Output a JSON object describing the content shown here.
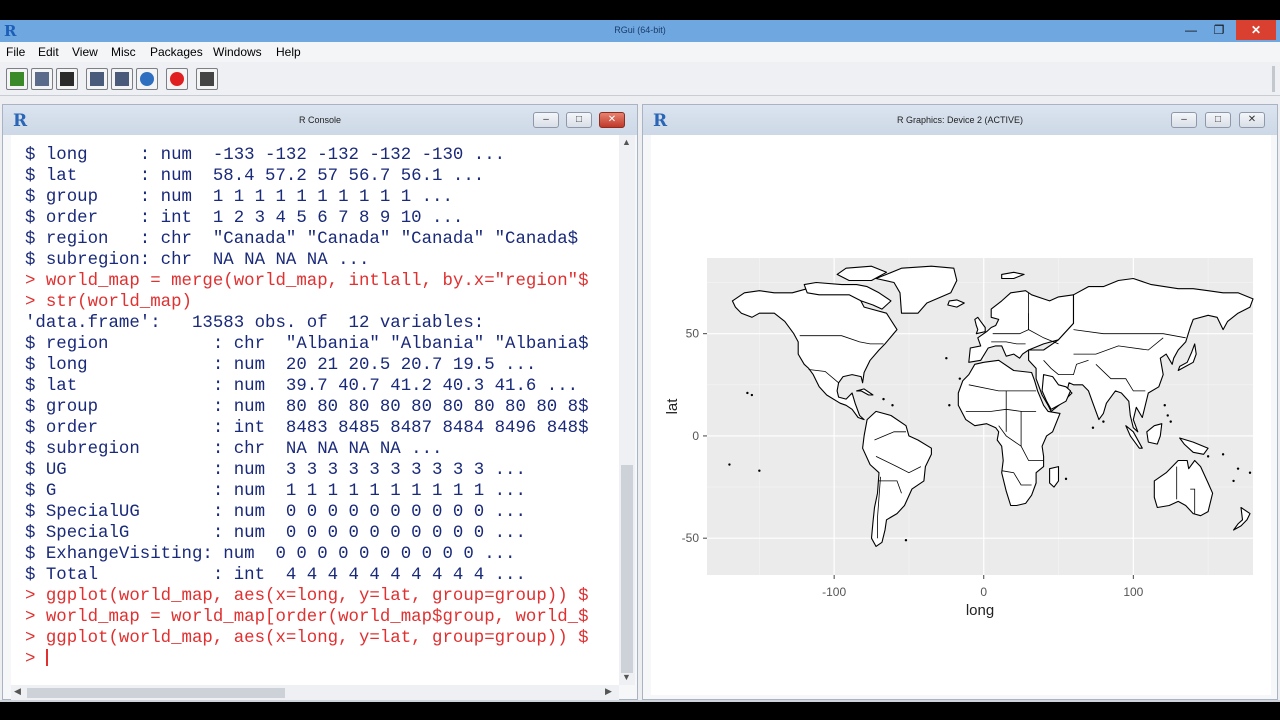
{
  "app": {
    "title": "RGui (64-bit)",
    "menu": [
      "File",
      "Edit",
      "View",
      "Misc",
      "Packages",
      "Windows",
      "Help"
    ],
    "toolbar": [
      {
        "name": "open-script-icon",
        "color": "#3a8a2a"
      },
      {
        "name": "load-workspace-icon",
        "color": "#5a6a8a"
      },
      {
        "name": "save-workspace-icon",
        "color": "#2b2b2b"
      },
      {
        "name": "copy-icon",
        "color": "#4a5a7a"
      },
      {
        "name": "copy-paste-icon",
        "color": "#4a5a7a"
      },
      {
        "name": "refresh-icon",
        "color": "#2f6fbf"
      },
      {
        "name": "stop-icon",
        "color": "#e02020"
      },
      {
        "name": "print-icon",
        "color": "#444444"
      }
    ]
  },
  "console": {
    "title": "R Console",
    "lines": [
      {
        "type": "out",
        "text": "$ long     : num  -133 -132 -132 -132 -130 ..."
      },
      {
        "type": "out",
        "text": "$ lat      : num  58.4 57.2 57 56.7 56.1 ..."
      },
      {
        "type": "out",
        "text": "$ group    : num  1 1 1 1 1 1 1 1 1 1 ..."
      },
      {
        "type": "out",
        "text": "$ order    : int  1 2 3 4 5 6 7 8 9 10 ..."
      },
      {
        "type": "out",
        "text": "$ region   : chr  \"Canada\" \"Canada\" \"Canada\" \"Canada$"
      },
      {
        "type": "out",
        "text": "$ subregion: chr  NA NA NA NA ..."
      },
      {
        "type": "cmd",
        "text": "> world_map = merge(world_map, intlall, by.x=\"region\"$"
      },
      {
        "type": "cmd",
        "text": "> str(world_map)"
      },
      {
        "type": "out",
        "text": "'data.frame':   13583 obs. of  12 variables:"
      },
      {
        "type": "out",
        "text": "$ region          : chr  \"Albania\" \"Albania\" \"Albania$"
      },
      {
        "type": "out",
        "text": "$ long            : num  20 21 20.5 20.7 19.5 ..."
      },
      {
        "type": "out",
        "text": "$ lat             : num  39.7 40.7 41.2 40.3 41.6 ..."
      },
      {
        "type": "out",
        "text": "$ group           : num  80 80 80 80 80 80 80 80 80 8$"
      },
      {
        "type": "out",
        "text": "$ order           : int  8483 8485 8487 8484 8496 848$"
      },
      {
        "type": "out",
        "text": "$ subregion       : chr  NA NA NA NA ..."
      },
      {
        "type": "out",
        "text": "$ UG              : num  3 3 3 3 3 3 3 3 3 3 ..."
      },
      {
        "type": "out",
        "text": "$ G               : num  1 1 1 1 1 1 1 1 1 1 ..."
      },
      {
        "type": "out",
        "text": "$ SpecialUG       : num  0 0 0 0 0 0 0 0 0 0 ..."
      },
      {
        "type": "out",
        "text": "$ SpecialG        : num  0 0 0 0 0 0 0 0 0 0 ..."
      },
      {
        "type": "out",
        "text": "$ ExhangeVisiting: num  0 0 0 0 0 0 0 0 0 0 ..."
      },
      {
        "type": "out",
        "text": "$ Total           : int  4 4 4 4 4 4 4 4 4 4 ..."
      },
      {
        "type": "cmd",
        "text": "> ggplot(world_map, aes(x=long, y=lat, group=group)) $"
      },
      {
        "type": "cmd",
        "text": "> world_map = world_map[order(world_map$group, world_$"
      },
      {
        "type": "cmd",
        "text": "> ggplot(world_map, aes(x=long, y=lat, group=group)) $"
      },
      {
        "type": "prompt",
        "text": "> "
      }
    ]
  },
  "graphics": {
    "title": "R Graphics: Device 2 (ACTIVE)",
    "xlabel": "long",
    "ylabel": "lat",
    "x_ticks": [
      "-100",
      "0",
      "100"
    ],
    "y_ticks": [
      "50",
      "0",
      "-50"
    ]
  },
  "chart_data": {
    "type": "map",
    "xlabel": "long",
    "ylabel": "lat",
    "xlim": [
      -185,
      180
    ],
    "ylim": [
      -68,
      87
    ],
    "x_ticks": [
      -100,
      0,
      100
    ],
    "y_ticks": [
      -50,
      0,
      50
    ],
    "grid": true,
    "panel_color": "#ebebeb",
    "fill": "#ffffff",
    "stroke": "#000000"
  }
}
